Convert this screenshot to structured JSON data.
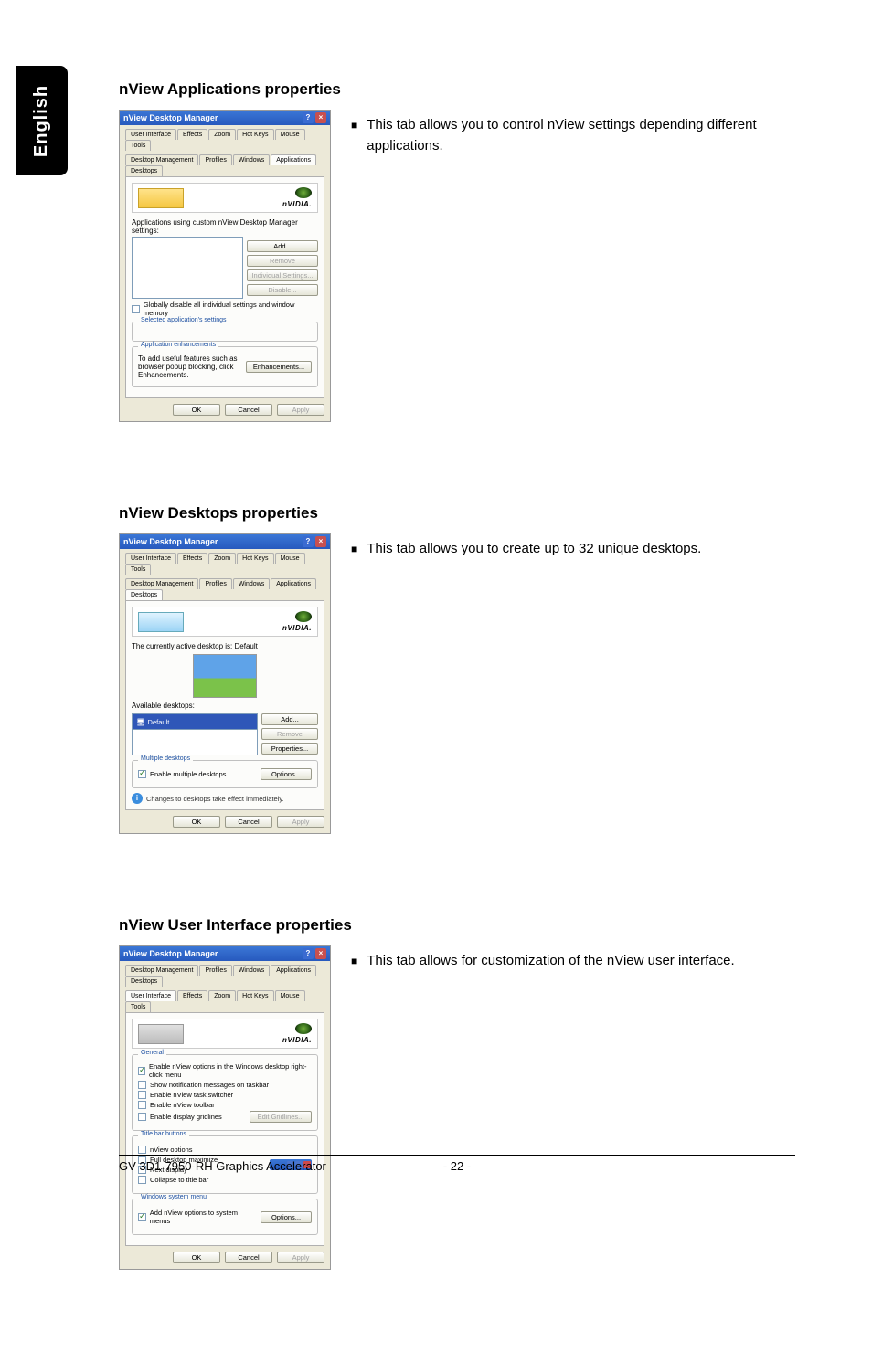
{
  "langTab": "English",
  "footer": {
    "left": "GV-3D1-7950-RH Graphics Accelerator",
    "page": "- 22 -"
  },
  "common": {
    "dlgTitle": "nView Desktop Manager",
    "brand": "nVIDIA.",
    "ok": "OK",
    "cancel": "Cancel",
    "apply": "Apply"
  },
  "tabs": {
    "userInterface": "User Interface",
    "effects": "Effects",
    "zoom": "Zoom",
    "hotKeys": "Hot Keys",
    "mouse": "Mouse",
    "tools": "Tools",
    "desktopMgmt": "Desktop Management",
    "profiles": "Profiles",
    "windows": "Windows",
    "applications": "Applications",
    "desktops": "Desktops"
  },
  "apps": {
    "heading": "nView Applications properties",
    "desc": "This tab allows you to control nView settings depending different applications.",
    "listLabel": "Applications using custom nView Desktop Manager settings:",
    "add": "Add...",
    "remove": "Remove",
    "individual": "Individual Settings...",
    "disable": "Disable...",
    "globalDisable": "Globally disable all individual settings and window memory",
    "selectedGroup": "Selected application's settings",
    "enhGroup": "Application enhancements",
    "enhText": "To add useful features such as browser popup blocking, click Enhancements.",
    "enhBtn": "Enhancements..."
  },
  "desktops": {
    "heading": "nView Desktops properties",
    "desc": "This tab allows you to create up to 32 unique desktops.",
    "activeLabel": "The currently active desktop is: Default",
    "availLabel": "Available desktops:",
    "defaultItem": "Default",
    "add": "Add...",
    "remove": "Remove",
    "properties": "Properties...",
    "multiGroup": "Multiple desktops",
    "enableMulti": "Enable multiple desktops",
    "options": "Options...",
    "note": "Changes to desktops take effect immediately."
  },
  "ui": {
    "heading": "nView User Interface properties",
    "desc": "This tab allows for customization of the nView user interface.",
    "generalGroup": "General",
    "opt1": "Enable nView options in the Windows desktop right-click menu",
    "opt2": "Show notification messages on taskbar",
    "opt3": "Enable nView task switcher",
    "opt4": "Enable nView toolbar",
    "opt5": "Enable display gridlines",
    "editGrid": "Edit Gridlines...",
    "titleBarGroup": "Title bar buttons",
    "tb1": "nView options",
    "tb2": "Full desktop maximize",
    "tb3": "Next display",
    "tb4": "Collapse to title bar",
    "sysMenuGroup": "Windows system menu",
    "sysOpt": "Add nView options to system menus",
    "options": "Options..."
  }
}
